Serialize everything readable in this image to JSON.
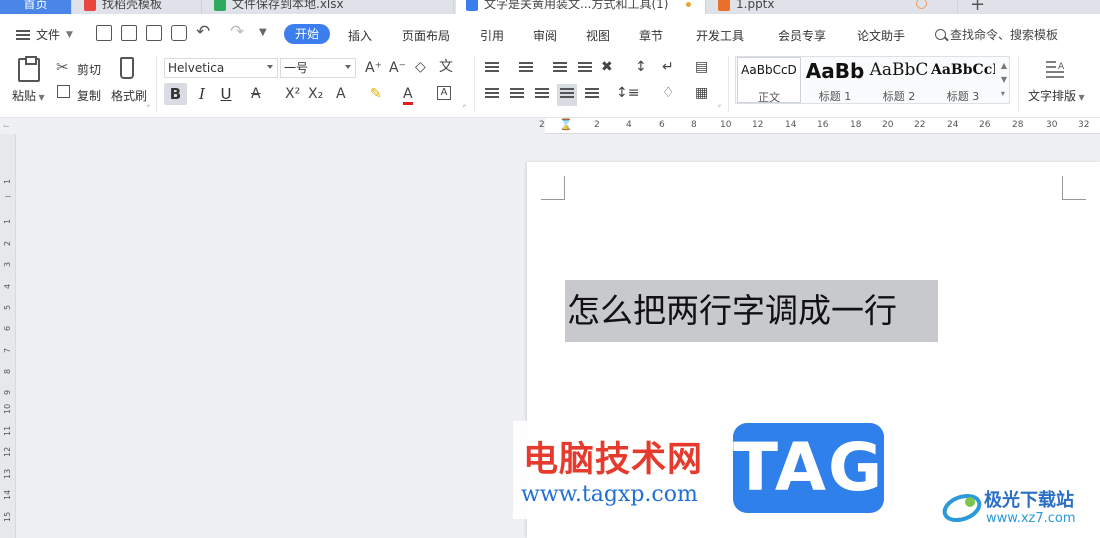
{
  "tabs": [
    {
      "label": "首页"
    },
    {
      "label": "找稻壳模板",
      "icon_color": "#e8453c"
    },
    {
      "label": "文件保存到本地.xlsx",
      "icon_color": "#2eaa5c"
    },
    {
      "label": "文字是关黄用装文...方式和工具(1)",
      "icon_color": "#3d7eef"
    },
    {
      "label": "1.pptx",
      "icon_color": "#e8702a"
    }
  ],
  "new_tab_label": "+",
  "menubar": {
    "file_label": "文件",
    "active_tab": "开始",
    "tabs": [
      "插入",
      "页面布局",
      "引用",
      "审阅",
      "视图",
      "章节",
      "开发工具",
      "会员专享",
      "论文助手"
    ],
    "search_label": "查找命令、搜索模板"
  },
  "ribbon": {
    "paste_label": "粘贴",
    "cut_label": "剪切",
    "copy_label": "复制",
    "format_painter_label": "格式刷",
    "font_name": "Helvetica",
    "font_size": "一号",
    "bold_label": "B",
    "italic_label": "I",
    "underline_label": "U",
    "styles": [
      {
        "sample": "AaBbCcD",
        "name": "正文"
      },
      {
        "sample": "AaBb",
        "name": "标题 1"
      },
      {
        "sample": "AaBbC",
        "name": "标题 2"
      },
      {
        "sample": "AaBbCcI",
        "name": "标题 3"
      }
    ],
    "text_layout_label": "文字排版"
  },
  "ruler": {
    "h_numbers": [
      "2",
      "2",
      "4",
      "6",
      "8",
      "10",
      "12",
      "14",
      "16",
      "18",
      "20",
      "22",
      "24",
      "26",
      "28",
      "30",
      "32"
    ],
    "v_numbers": [
      "1",
      "1",
      "2",
      "3",
      "4",
      "5",
      "6",
      "7",
      "8",
      "9",
      "10",
      "11",
      "12",
      "13",
      "14",
      "15"
    ]
  },
  "document": {
    "selected_text": "怎么把两行字调成一行"
  },
  "watermarks": {
    "site_cn": "电脑技术网",
    "site_url": "www.tagxp.com",
    "tag_label": "TAG",
    "logo_cn": "极光下载站",
    "logo_url": "www.xz7.com"
  },
  "colors": {
    "accent": "#3d7eef",
    "home_tab": "#4a86e8",
    "selection": "#c7c9cc",
    "watermark_red": "#e63a2d",
    "watermark_blue": "#2f80ea"
  }
}
